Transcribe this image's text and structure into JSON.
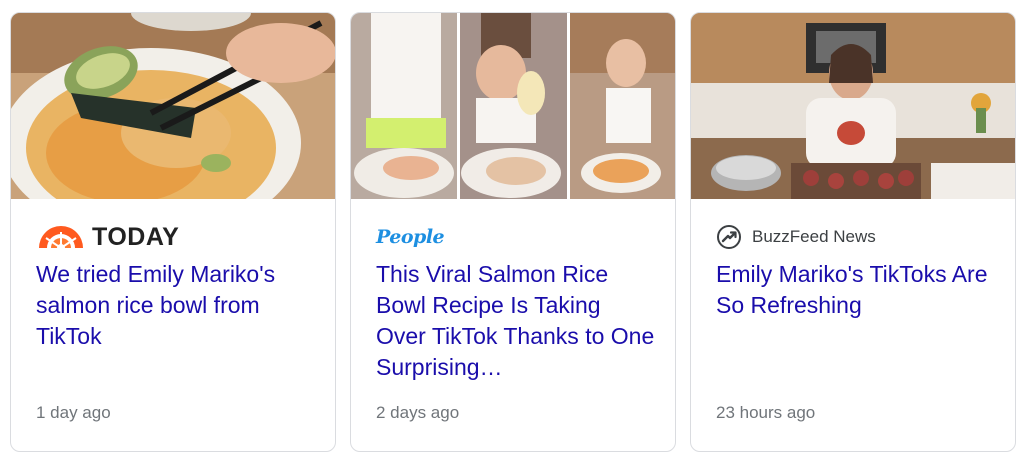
{
  "cards": [
    {
      "source": "TODAY",
      "title": "We tried Emily Mariko's salmon rice bowl from TikTok",
      "time": "1 day ago",
      "logo_color": "#ff5a1f"
    },
    {
      "source": "People",
      "title": "This Viral Salmon Rice Bowl Recipe Is Taking Over TikTok Thanks to One Surprising…",
      "time": "2 days ago",
      "logo_color": "#1d8fe1"
    },
    {
      "source": "BuzzFeed News",
      "title": "Emily Mariko's TikToks Are So Refreshing",
      "time": "23 hours ago",
      "logo_color": "#3c4043"
    }
  ],
  "colors": {
    "title_link": "#1a0dab",
    "meta_text": "#70757a",
    "card_border": "#dadce0"
  }
}
